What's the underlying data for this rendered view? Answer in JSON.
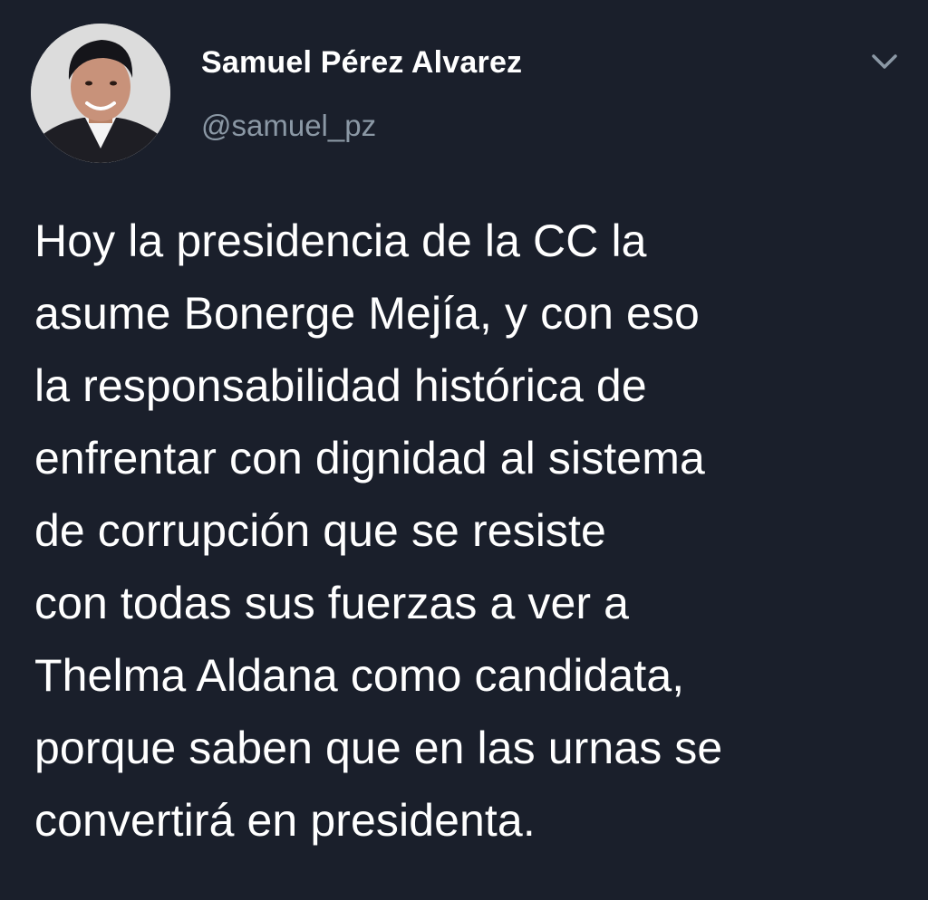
{
  "tweet": {
    "author": {
      "name": "Samuel Pérez Alvarez",
      "handle": "@samuel_pz"
    },
    "text_lines": [
      "Hoy la presidencia de la CC la",
      "asume Bonerge Mejía, y con eso",
      "la responsabilidad histórica de",
      "enfrentar con dignidad al sistema",
      "de corrupción que se resiste",
      "con todas sus fuerzas a ver a",
      "Thelma Aldana como candidata,",
      "porque saben que en las urnas se",
      "convertirá en presidenta."
    ]
  },
  "icons": {
    "menu": "chevron-down-icon",
    "avatar": "profile-photo"
  },
  "colors": {
    "background": "#1a1f2b",
    "primary_text": "#ffffff",
    "secondary_text": "#8b98a5"
  }
}
